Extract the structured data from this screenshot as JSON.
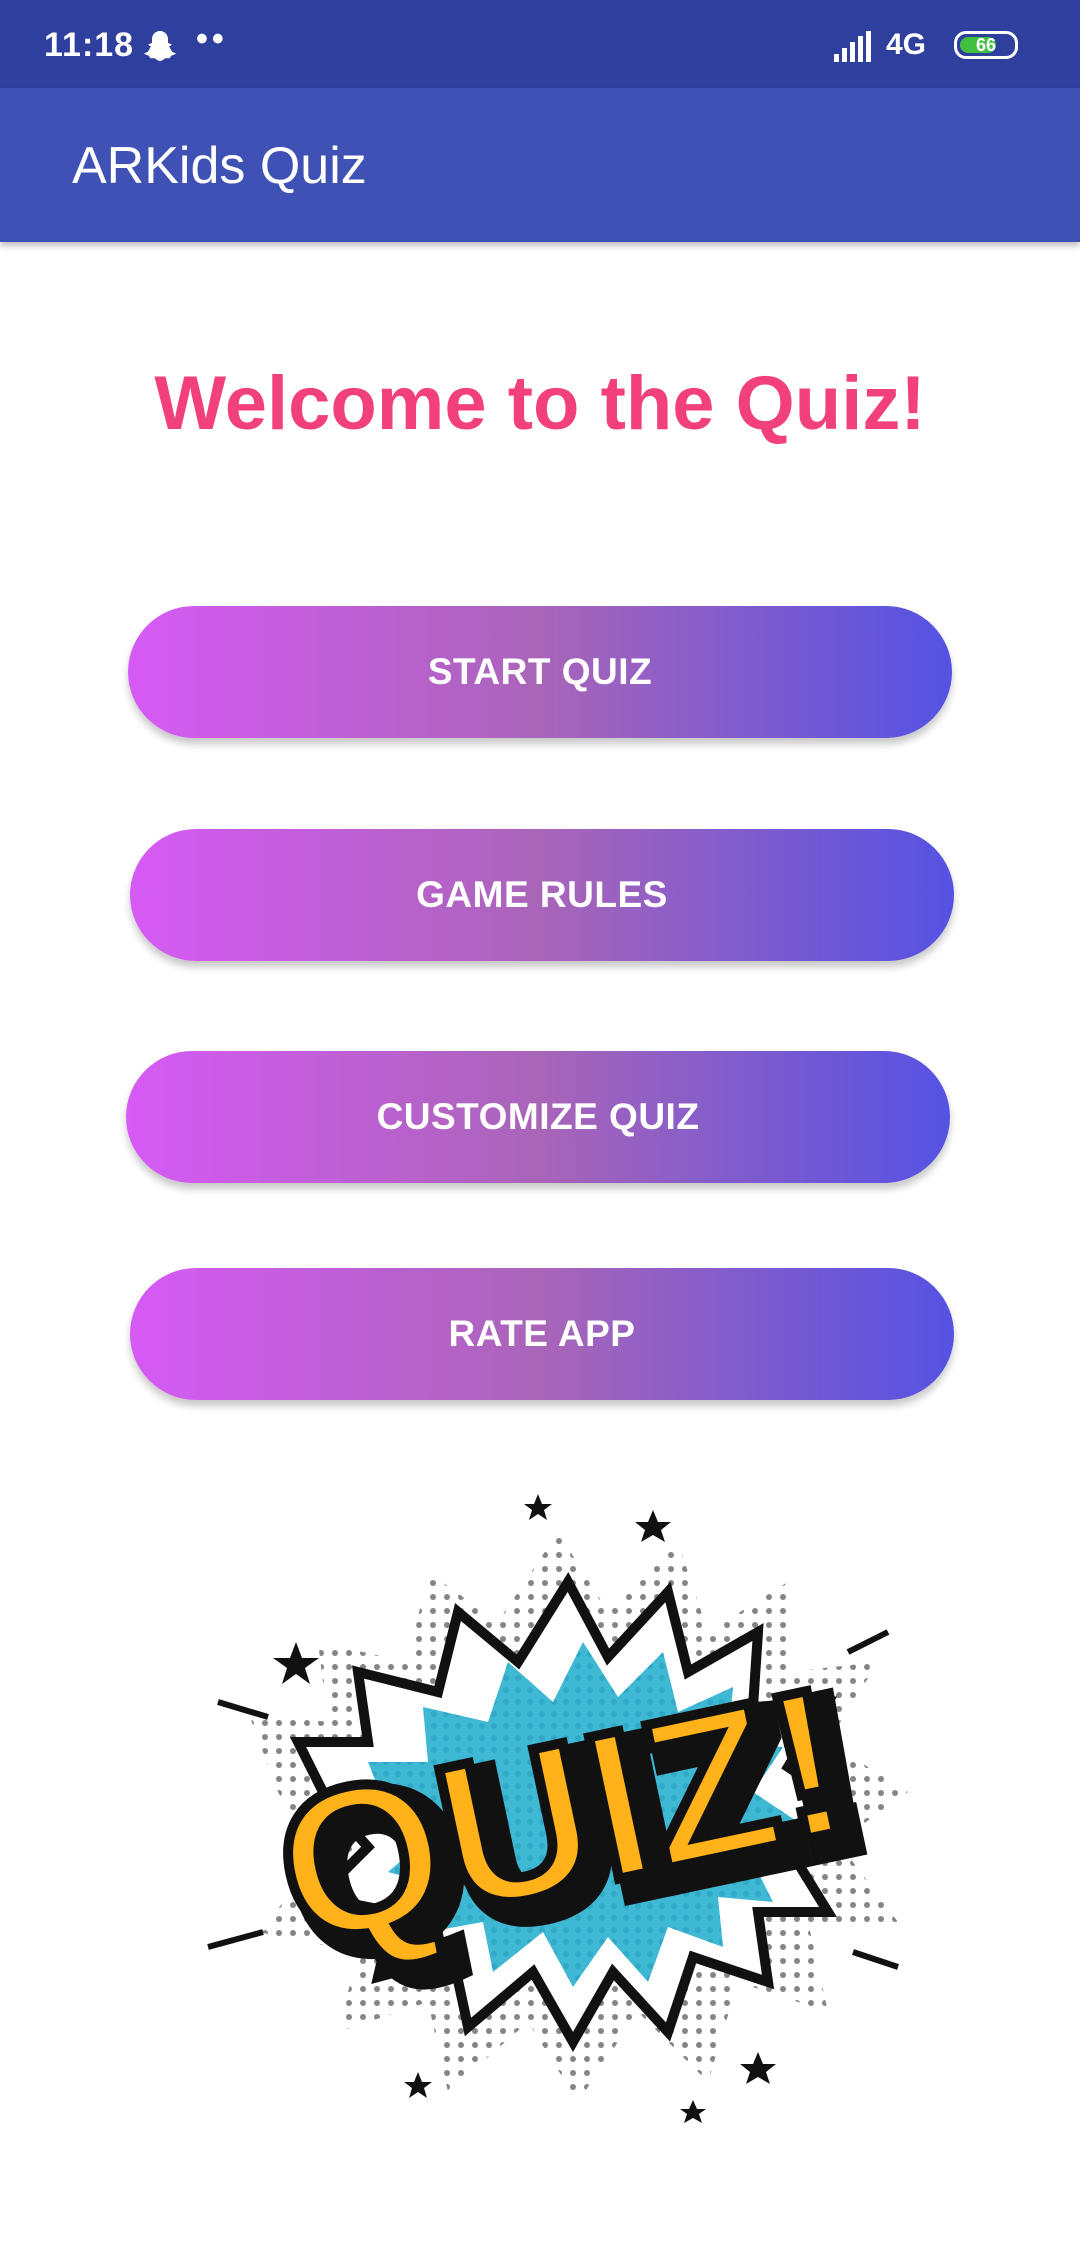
{
  "status_bar": {
    "time": "11:18",
    "dots": "••",
    "network": "4G",
    "battery": "66",
    "icons": [
      "snapchat-icon",
      "signal-icon",
      "battery-icon"
    ]
  },
  "app_bar": {
    "title": "ARKids Quiz"
  },
  "main": {
    "welcome": "Welcome to the Quiz!",
    "buttons": [
      {
        "label": "START QUIZ"
      },
      {
        "label": "GAME RULES"
      },
      {
        "label": "CUSTOMIZE QUIZ"
      },
      {
        "label": "RATE APP"
      }
    ],
    "illustration_text": "QUIZ!"
  },
  "colors": {
    "status_bar": "#2f3f9e",
    "app_bar": "#3f51b5",
    "welcome_text": "#f2407a",
    "button_gradient_start": "#d65af5",
    "button_gradient_mid": "#a965b8",
    "button_gradient_end": "#5552e3"
  }
}
